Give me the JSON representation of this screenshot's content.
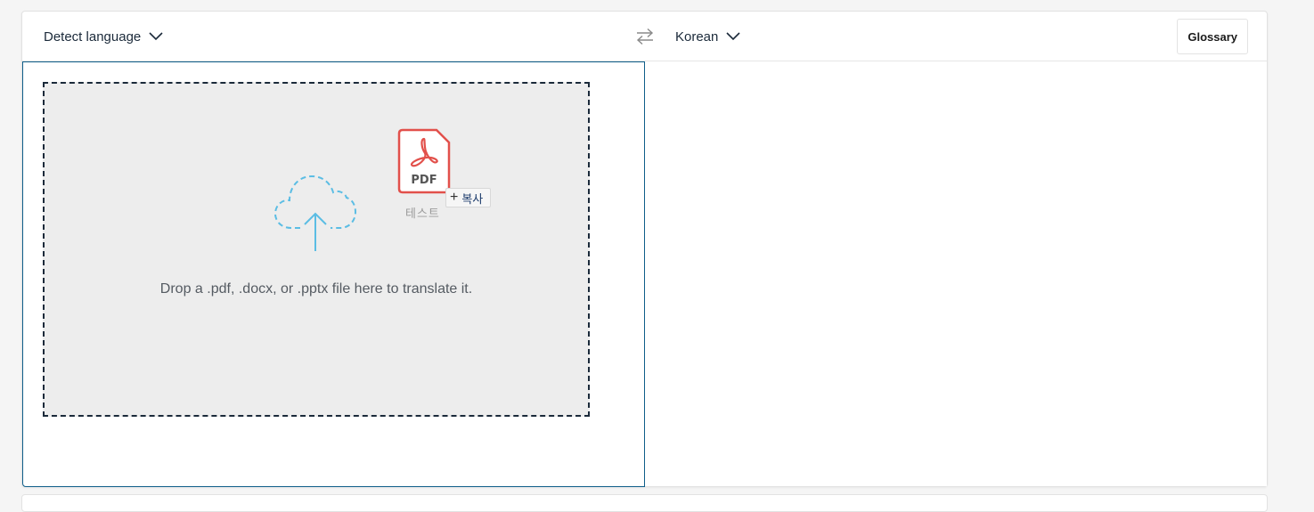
{
  "header": {
    "source_language": "Detect language",
    "target_language": "Korean",
    "glossary_label": "Glossary"
  },
  "dropzone": {
    "instruction": "Drop a .pdf, .docx, or .pptx file here to translate it."
  },
  "drag_ghost": {
    "file_type": "PDF",
    "file_name": "테스트",
    "action_label": "복사",
    "action_symbol": "+"
  },
  "colors": {
    "accent_border": "#0f5e8a",
    "dropzone_bg": "#ededed",
    "cloud": "#5bbde4",
    "pdf_red": "#e2504b"
  },
  "icons": [
    "chevron-down-icon",
    "swap-arrows-icon",
    "cloud-upload-icon",
    "pdf-file-icon"
  ]
}
